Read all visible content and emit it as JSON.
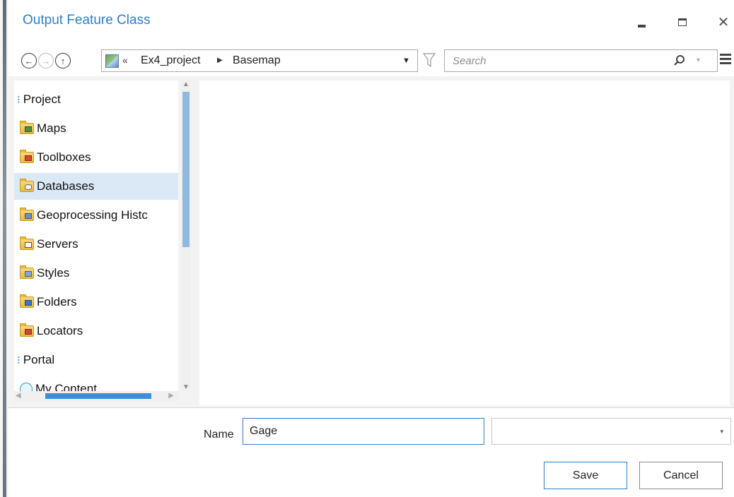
{
  "dialog": {
    "title": "Output Feature Class",
    "title_color": "#2e7ec6"
  },
  "window_controls": {
    "minimize_icon": "minimize-icon",
    "maximize_icon": "maximize-icon",
    "close_glyph": "✕"
  },
  "navigation": {
    "back_glyph": "←",
    "forward_glyph": "→",
    "up_glyph": "↑"
  },
  "pathbar": {
    "overflow_glyph": "«",
    "crumbs": [
      "Ex4_project",
      "Basemap"
    ],
    "separator_glyph": "▶",
    "dropdown_glyph": "▼"
  },
  "search": {
    "placeholder": "Search",
    "icon": "search-icon",
    "dropdown_glyph": "▾"
  },
  "tree": {
    "items": [
      {
        "label": "Project",
        "icon": "expander",
        "group": true
      },
      {
        "label": "Maps",
        "icon": "maps-folder-icon"
      },
      {
        "label": "Toolboxes",
        "icon": "toolboxes-folder-icon"
      },
      {
        "label": "Databases",
        "icon": "databases-folder-icon",
        "selected": true
      },
      {
        "label": "Geoprocessing Histc",
        "icon": "geoprocessing-history-icon"
      },
      {
        "label": "Servers",
        "icon": "servers-folder-icon"
      },
      {
        "label": "Styles",
        "icon": "styles-folder-icon"
      },
      {
        "label": "Folders",
        "icon": "folders-folder-icon"
      },
      {
        "label": "Locators",
        "icon": "locators-folder-icon"
      },
      {
        "label": "Portal",
        "icon": "expander",
        "group": true
      },
      {
        "label": "My Content",
        "icon": "my-content-icon"
      }
    ],
    "selected_color": "#dbe9f7"
  },
  "footer": {
    "name_label": "Name",
    "name_value": "Gage",
    "type_value": "",
    "save_label": "Save",
    "cancel_label": "Cancel",
    "select_arrow": "▾"
  },
  "scrollbars": {
    "up": "▲",
    "down": "▼",
    "left": "◀",
    "right": "▶",
    "thumb_color": "#8fb9dd"
  }
}
